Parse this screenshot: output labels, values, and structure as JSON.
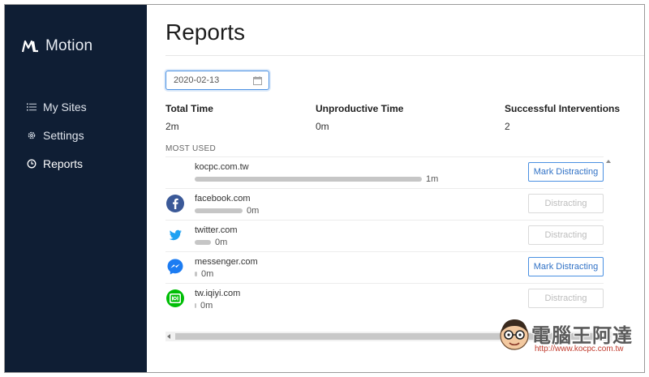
{
  "app": {
    "name": "Motion",
    "logo_text": "M"
  },
  "sidebar": {
    "items": [
      {
        "label": "My Sites",
        "icon": "list-icon"
      },
      {
        "label": "Settings",
        "icon": "gear-icon"
      },
      {
        "label": "Reports",
        "icon": "clock-icon",
        "active": true
      }
    ]
  },
  "page": {
    "title": "Reports",
    "date_value": "2020-02-13"
  },
  "stats": [
    {
      "label": "Total Time",
      "value": "2m"
    },
    {
      "label": "Unproductive Time",
      "value": "0m"
    },
    {
      "label": "Successful Interventions",
      "value": "2"
    }
  ],
  "most_used": {
    "label": "MOST USED",
    "rows": [
      {
        "site": "kocpc.com.tw",
        "duration": "1m",
        "usage_fraction": 1.0,
        "button": "Mark Distracting",
        "button_enabled": true,
        "icon": "none"
      },
      {
        "site": "facebook.com",
        "duration": "0m",
        "usage_fraction": 0.21,
        "button": "Distracting",
        "button_enabled": false,
        "icon": "facebook-icon"
      },
      {
        "site": "twitter.com",
        "duration": "0m",
        "usage_fraction": 0.07,
        "button": "Distracting",
        "button_enabled": false,
        "icon": "twitter-icon"
      },
      {
        "site": "messenger.com",
        "duration": "0m",
        "usage_fraction": 0.012,
        "button": "Mark Distracting",
        "button_enabled": true,
        "icon": "messenger-icon"
      },
      {
        "site": "tw.iqiyi.com",
        "duration": "0m",
        "usage_fraction": 0.008,
        "button": "Distracting",
        "button_enabled": false,
        "icon": "iqiyi-icon"
      }
    ]
  },
  "watermark": {
    "text": "電腦王阿達",
    "url": "http://www.kocpc.com.tw"
  },
  "colors": {
    "sidebar_bg": "#0f1e34",
    "accent": "#4a90e2",
    "facebook": "#3b5998",
    "twitter": "#1da1f2",
    "messenger": "#1c7cf2",
    "iqiyi": "#00be06"
  }
}
